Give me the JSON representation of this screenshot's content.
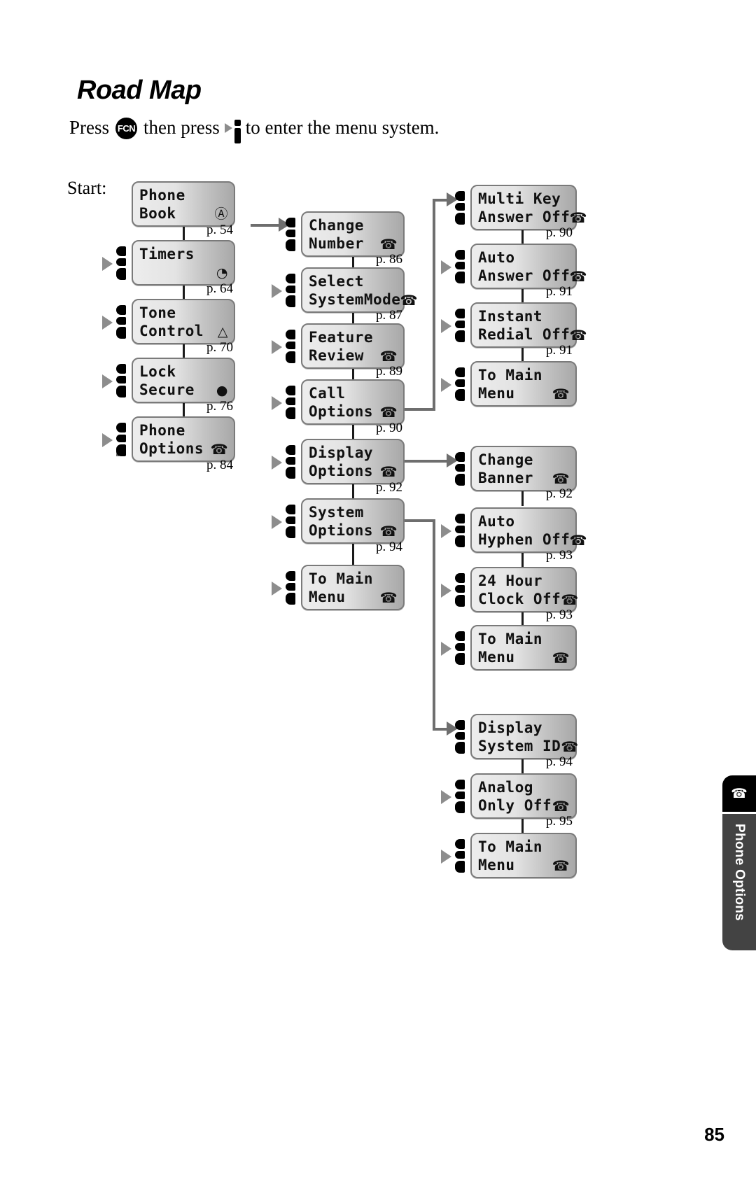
{
  "header": {
    "title": "Road Map",
    "instruction_part1": "Press",
    "fcn_key_label": "FCN",
    "instruction_part2": "then press",
    "instruction_part3": "to enter the menu system.",
    "start_label": "Start:"
  },
  "columns": {
    "main_menu": [
      {
        "line1": "Phone",
        "line2": "Book",
        "icon": "book-icon",
        "glyph": "Ⓐ",
        "page": "p. 54",
        "has_pointer": false
      },
      {
        "line1": "Timers",
        "line2": "",
        "icon": "clock-icon",
        "glyph": "◔",
        "page": "p. 64",
        "has_pointer": true
      },
      {
        "line1": "Tone",
        "line2": "Control",
        "icon": "bell-icon",
        "glyph": "△",
        "page": "p. 70",
        "has_pointer": true
      },
      {
        "line1": "Lock",
        "line2": "Secure",
        "icon": "lock-icon",
        "glyph": "●",
        "page": "p. 76",
        "has_pointer": true
      },
      {
        "line1": "Phone",
        "line2": "Options",
        "icon": "telephone-icon",
        "glyph": "☎",
        "page": "p. 84",
        "has_pointer": true
      }
    ],
    "phone_options": [
      {
        "line1": "Change",
        "line2": "Number",
        "icon": "telephone-icon",
        "glyph": "☎",
        "page": "p. 86",
        "has_pointer": true
      },
      {
        "line1": "Select",
        "line2": "SystemMode",
        "icon": "telephone-icon",
        "glyph": "☎",
        "page": "p. 87",
        "has_pointer": true
      },
      {
        "line1": "Feature",
        "line2": "Review",
        "icon": "telephone-icon",
        "glyph": "☎",
        "page": "p. 89",
        "has_pointer": true
      },
      {
        "line1": "Call",
        "line2": "Options",
        "icon": "telephone-icon",
        "glyph": "☎",
        "page": "p. 90",
        "has_pointer": true
      },
      {
        "line1": "Display",
        "line2": "Options",
        "icon": "telephone-icon",
        "glyph": "☎",
        "page": "p. 92",
        "has_pointer": true
      },
      {
        "line1": "System",
        "line2": "Options",
        "icon": "telephone-icon",
        "glyph": "☎",
        "page": "p. 94",
        "has_pointer": true
      },
      {
        "line1": "To Main",
        "line2": "Menu",
        "icon": "telephone-icon",
        "glyph": "☎",
        "page": "",
        "has_pointer": true
      }
    ],
    "call_options": [
      {
        "line1": "Multi Key",
        "line2": "Answer Off",
        "icon": "telephone-icon",
        "glyph": "☎",
        "page": "p. 90",
        "has_pointer": true
      },
      {
        "line1": "Auto",
        "line2": "Answer Off",
        "icon": "telephone-icon",
        "glyph": "☎",
        "page": "p. 91",
        "has_pointer": true
      },
      {
        "line1": "Instant",
        "line2": "Redial Off",
        "icon": "telephone-icon",
        "glyph": "☎",
        "page": "p. 91",
        "has_pointer": true
      },
      {
        "line1": "To Main",
        "line2": "Menu",
        "icon": "telephone-icon",
        "glyph": "☎",
        "page": "",
        "has_pointer": true
      }
    ],
    "display_options": [
      {
        "line1": "Change",
        "line2": "Banner",
        "icon": "telephone-icon",
        "glyph": "☎",
        "page": "p. 92",
        "has_pointer": true
      },
      {
        "line1": "Auto",
        "line2": "Hyphen Off",
        "icon": "telephone-icon",
        "glyph": "☎",
        "page": "p. 93",
        "has_pointer": true
      },
      {
        "line1": "24 Hour",
        "line2": "Clock Off",
        "icon": "telephone-icon",
        "glyph": "☎",
        "page": "p. 93",
        "has_pointer": true
      },
      {
        "line1": "To Main",
        "line2": "Menu",
        "icon": "telephone-icon",
        "glyph": "☎",
        "page": "",
        "has_pointer": true
      }
    ],
    "system_options": [
      {
        "line1": "Display",
        "line2": "System ID",
        "icon": "telephone-icon",
        "glyph": "☎",
        "page": "p. 94",
        "has_pointer": true
      },
      {
        "line1": "Analog",
        "line2": "Only Off",
        "icon": "telephone-icon",
        "glyph": "☎",
        "page": "p. 95",
        "has_pointer": true
      },
      {
        "line1": "To Main",
        "line2": "Menu",
        "icon": "telephone-icon",
        "glyph": "☎",
        "page": "",
        "has_pointer": true
      }
    ]
  },
  "side_tab": {
    "icon": "telephone-icon",
    "glyph": "☎",
    "label": "Phone Options"
  },
  "footer": {
    "page_number": "85"
  },
  "colors": {
    "lcd_light": "#ededed",
    "lcd_dark": "#a8a8a8",
    "lcd_border": "#7a7a7a",
    "connector_black": "#1a1a1a",
    "connector_grey": "#6e6e6e",
    "tab_dark": "#434343"
  }
}
